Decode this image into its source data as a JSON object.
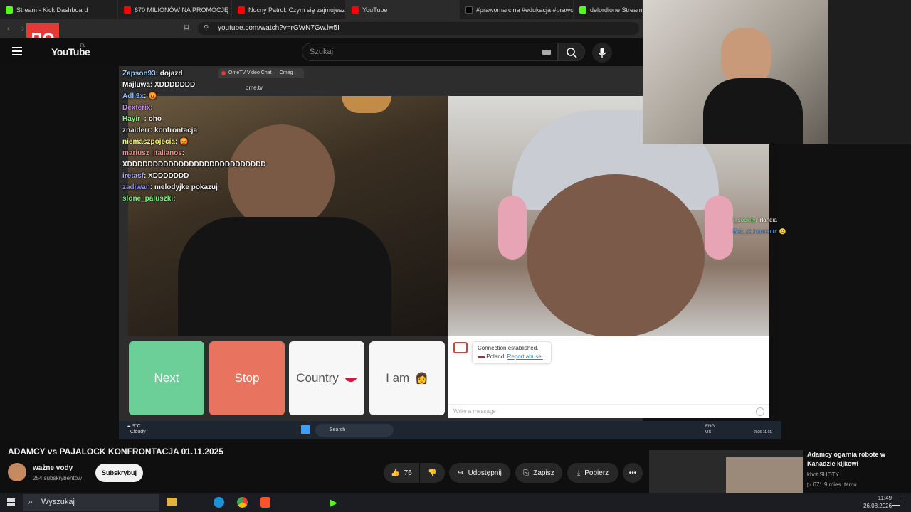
{
  "browser": {
    "tabs": [
      {
        "label": "Stream - Kick Dashboard",
        "color": "#53fc18"
      },
      {
        "label": "670 MILIONÓW NA PROMOCJĘ PO",
        "color": "#ff0000"
      },
      {
        "label": "Nocny Patrol: Czym się zajmujesz i",
        "color": "#ff0000"
      },
      {
        "label": "YouTube",
        "color": "#ff0000"
      },
      {
        "label": "#prawomarcina #edukacja #prawo",
        "color": "#000000"
      },
      {
        "label": "delordione Stream",
        "color": "#53fc18"
      }
    ],
    "url": "youtube.com/watch?v=rGWN7Gw.lw5I"
  },
  "youtube": {
    "logo": "YouTube",
    "region": "PL",
    "search_placeholder": "Szukaj"
  },
  "overlay_logo": "ΠO",
  "chat": [
    {
      "user": "Zapson93",
      "text": "dojazd",
      "color": "#9cf"
    },
    {
      "user": "Majluwa",
      "text": "XDDDDDDD",
      "color": "#fff"
    },
    {
      "user": "Adli9x",
      "text": "😡",
      "color": "#8bf"
    },
    {
      "user": "Dexterix",
      "text": "",
      "color": "#c8f"
    },
    {
      "user": "Hayir_",
      "text": "oho",
      "color": "#7f7"
    },
    {
      "user": "znaiderr",
      "text": "konfrontacja",
      "color": "#ddd"
    },
    {
      "user": "niemaszpojecia",
      "text": "😡",
      "color": "#ff5"
    },
    {
      "user": "mariusz_italianos",
      "text": "",
      "color": "#f88"
    },
    {
      "user": "",
      "text": "XDDDDDDDDDDDDDDDDDDDDDDDDDDD",
      "color": "#fff"
    },
    {
      "user": "iretasf",
      "text": "XDDDDDDD",
      "color": "#aaf"
    },
    {
      "user": "zadiwan",
      "text": "melodyjke pokazuj",
      "color": "#88f"
    },
    {
      "user": "slone_paluszki",
      "text": "",
      "color": "#6f6"
    }
  ],
  "ometv": {
    "tab_title": "OmeTV Video Chat — Omeg",
    "url": "ome.tv",
    "buttons": {
      "next": "Next",
      "stop": "Stop",
      "country": "Country",
      "iam": "I am"
    },
    "status_line1": "Connection established.",
    "status_country": "Poland.",
    "report": "Report abuse.",
    "message_placeholder": "Write a message"
  },
  "side_chat": [
    {
      "user": "f_society",
      "text": "irlandia"
    },
    {
      "user": "Bez_sakramentu",
      "text": "😐"
    }
  ],
  "inner_taskbar": {
    "weather_temp": "9°C",
    "weather_desc": "Cloudy",
    "search": "Search",
    "lang1": "ENG",
    "lang2": "US",
    "date": "2025-11-01"
  },
  "video": {
    "title": "ADAMCY vs PAJALOCK KONFRONTACJA 01.11.2025",
    "channel": "ważne vody",
    "subscribers": "254 subskrybentów",
    "subscribe": "Subskrybuj",
    "likes": "76",
    "share": "Udostępnij",
    "save": "Zapisz",
    "download": "Pobierz"
  },
  "recommended": {
    "title": "Adamcy ogarnia robote w Kanadzie kijkowi",
    "channel": "khot SHOTY",
    "meta": "▷ 671  9 mies. temu"
  },
  "windows": {
    "search": "Wyszukaj",
    "time": "11:49",
    "date": "26.08.2026"
  }
}
